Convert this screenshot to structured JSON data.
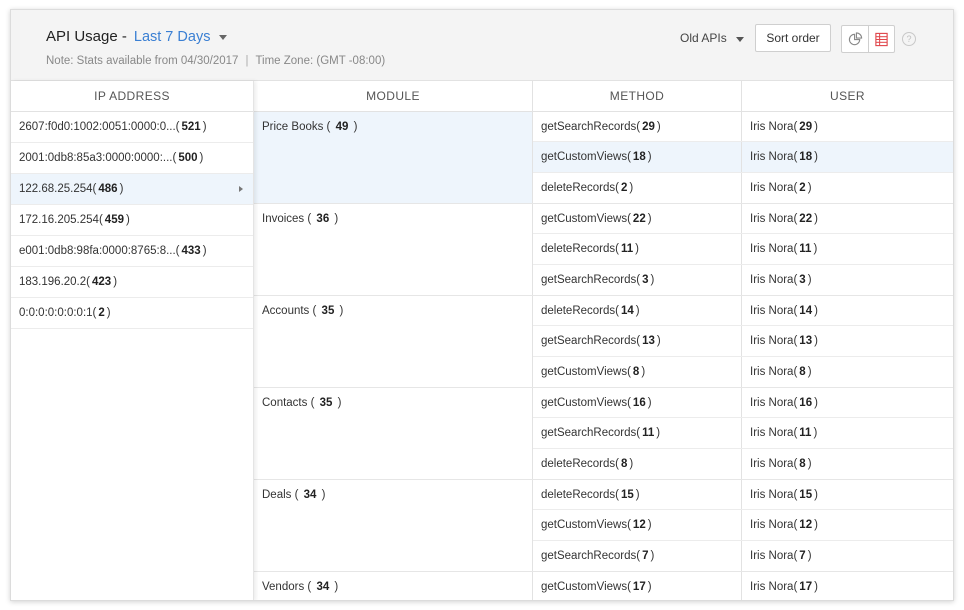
{
  "header": {
    "title": "API Usage -",
    "range": "Last 7 Days",
    "note": "Note: Stats available from 04/30/2017",
    "timezone": "Time Zone: (GMT -08:00)",
    "old_apis": "Old APIs",
    "sort_order": "Sort order",
    "help": "?"
  },
  "columns": {
    "ip": "IP ADDRESS",
    "module": "MODULE",
    "method": "METHOD",
    "user": "USER"
  },
  "ip_rows": [
    {
      "ip": "2607:f0d0:1002:0051:0000:0...",
      "count": "521"
    },
    {
      "ip": "2001:0db8:85a3:0000:0000:...",
      "count": "500"
    },
    {
      "ip": "122.68.25.254",
      "count": "486"
    },
    {
      "ip": "172.16.205.254",
      "count": "459"
    },
    {
      "ip": "e001:0db8:98fa:0000:8765:8...",
      "count": "433"
    },
    {
      "ip": "183.196.20.2",
      "count": "423"
    },
    {
      "ip": "0:0:0:0:0:0:0:1",
      "count": "2"
    }
  ],
  "modules": [
    {
      "name": "Price Books",
      "count": "49",
      "rows": [
        {
          "method": "getSearchRecords",
          "mcount": "29",
          "user": "Iris Nora",
          "ucount": "29"
        },
        {
          "method": "getCustomViews",
          "mcount": "18",
          "user": "Iris Nora",
          "ucount": "18"
        },
        {
          "method": "deleteRecords",
          "mcount": "2",
          "user": "Iris Nora",
          "ucount": "2"
        }
      ]
    },
    {
      "name": "Invoices",
      "count": "36",
      "rows": [
        {
          "method": "getCustomViews",
          "mcount": "22",
          "user": "Iris Nora",
          "ucount": "22"
        },
        {
          "method": "deleteRecords",
          "mcount": "11",
          "user": "Iris Nora",
          "ucount": "11"
        },
        {
          "method": "getSearchRecords",
          "mcount": "3",
          "user": "Iris Nora",
          "ucount": "3"
        }
      ]
    },
    {
      "name": "Accounts",
      "count": "35",
      "rows": [
        {
          "method": "deleteRecords",
          "mcount": "14",
          "user": "Iris Nora",
          "ucount": "14"
        },
        {
          "method": "getSearchRecords",
          "mcount": "13",
          "user": "Iris Nora",
          "ucount": "13"
        },
        {
          "method": "getCustomViews",
          "mcount": "8",
          "user": "Iris Nora",
          "ucount": "8"
        }
      ]
    },
    {
      "name": "Contacts",
      "count": "35",
      "rows": [
        {
          "method": "getCustomViews",
          "mcount": "16",
          "user": "Iris Nora",
          "ucount": "16"
        },
        {
          "method": "getSearchRecords",
          "mcount": "11",
          "user": "Iris Nora",
          "ucount": "11"
        },
        {
          "method": "deleteRecords",
          "mcount": "8",
          "user": "Iris Nora",
          "ucount": "8"
        }
      ]
    },
    {
      "name": "Deals",
      "count": "34",
      "rows": [
        {
          "method": "deleteRecords",
          "mcount": "15",
          "user": "Iris Nora",
          "ucount": "15"
        },
        {
          "method": "getCustomViews",
          "mcount": "12",
          "user": "Iris Nora",
          "ucount": "12"
        },
        {
          "method": "getSearchRecords",
          "mcount": "7",
          "user": "Iris Nora",
          "ucount": "7"
        }
      ]
    },
    {
      "name": "Vendors",
      "count": "34",
      "rows": [
        {
          "method": "getCustomViews",
          "mcount": "17",
          "user": "Iris Nora",
          "ucount": "17"
        }
      ]
    }
  ],
  "selection": {
    "ip_index": 2,
    "module_index": 0,
    "row_index": 1
  },
  "colors": {
    "accent": "#3a7fd3",
    "selected_bg": "#eef5fc",
    "pie_icon": "#888888",
    "table_icon": "#e0474c"
  },
  "icons": {
    "chart_view": "pie-chart-icon",
    "table_view": "table-icon",
    "dropdown": "caret-down-icon",
    "row_arrow": "chevron-right-icon"
  }
}
